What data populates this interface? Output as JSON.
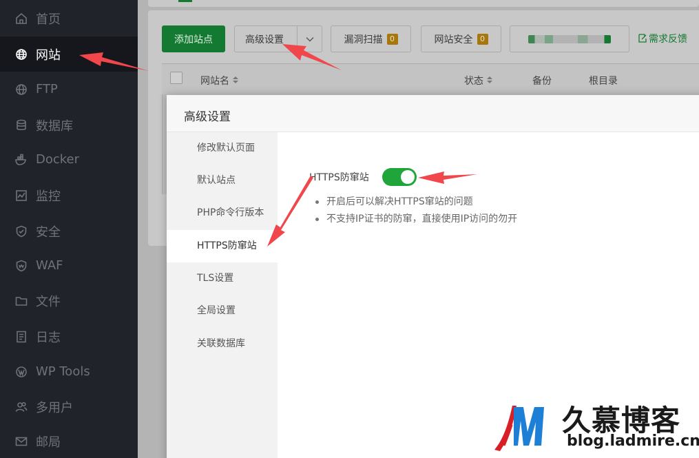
{
  "sidebar": {
    "items": [
      {
        "label": "首页",
        "icon": "home-icon"
      },
      {
        "label": "网站",
        "icon": "globe-icon",
        "active": true
      },
      {
        "label": "FTP",
        "icon": "globe-icon"
      },
      {
        "label": "数据库",
        "icon": "database-icon"
      },
      {
        "label": "Docker",
        "icon": "docker-icon"
      },
      {
        "label": "监控",
        "icon": "monitor-icon"
      },
      {
        "label": "安全",
        "icon": "shield-icon"
      },
      {
        "label": "WAF",
        "icon": "waf-shield-icon"
      },
      {
        "label": "文件",
        "icon": "folder-icon"
      },
      {
        "label": "日志",
        "icon": "log-icon"
      },
      {
        "label": "WP Tools",
        "icon": "wordpress-icon"
      },
      {
        "label": "多用户",
        "icon": "users-icon"
      },
      {
        "label": "邮局",
        "icon": "mail-icon"
      }
    ]
  },
  "toolbar": {
    "add_site": "添加站点",
    "advanced_settings": "高级设置",
    "vuln_scan": "漏洞扫描",
    "vuln_scan_count": "0",
    "site_security": "网站安全",
    "site_security_count": "0",
    "feedback": "需求反馈"
  },
  "table": {
    "headers": {
      "site_name": "网站名",
      "status": "状态",
      "backup": "备份",
      "root_dir": "根目录"
    }
  },
  "modal": {
    "title": "高级设置",
    "menu": [
      "修改默认页面",
      "默认站点",
      "PHP命令行版本",
      "HTTPS防窜站",
      "TLS设置",
      "全局设置",
      "关联数据库"
    ],
    "active_menu_index": 3,
    "setting": {
      "label": "HTTPS防窜站",
      "enabled": true,
      "tips": [
        "开启后可以解决HTTPS窜站的问题",
        "不支持IP证书的防窜，直接使用IP访问的勿开"
      ]
    }
  },
  "watermark": {
    "brand_cn": "久慕博客",
    "url": "blog.ladmire.cn"
  },
  "colors": {
    "accent_green": "#20a53a",
    "sidebar_bg": "#20232a",
    "annotation_red": "#f0474c"
  }
}
